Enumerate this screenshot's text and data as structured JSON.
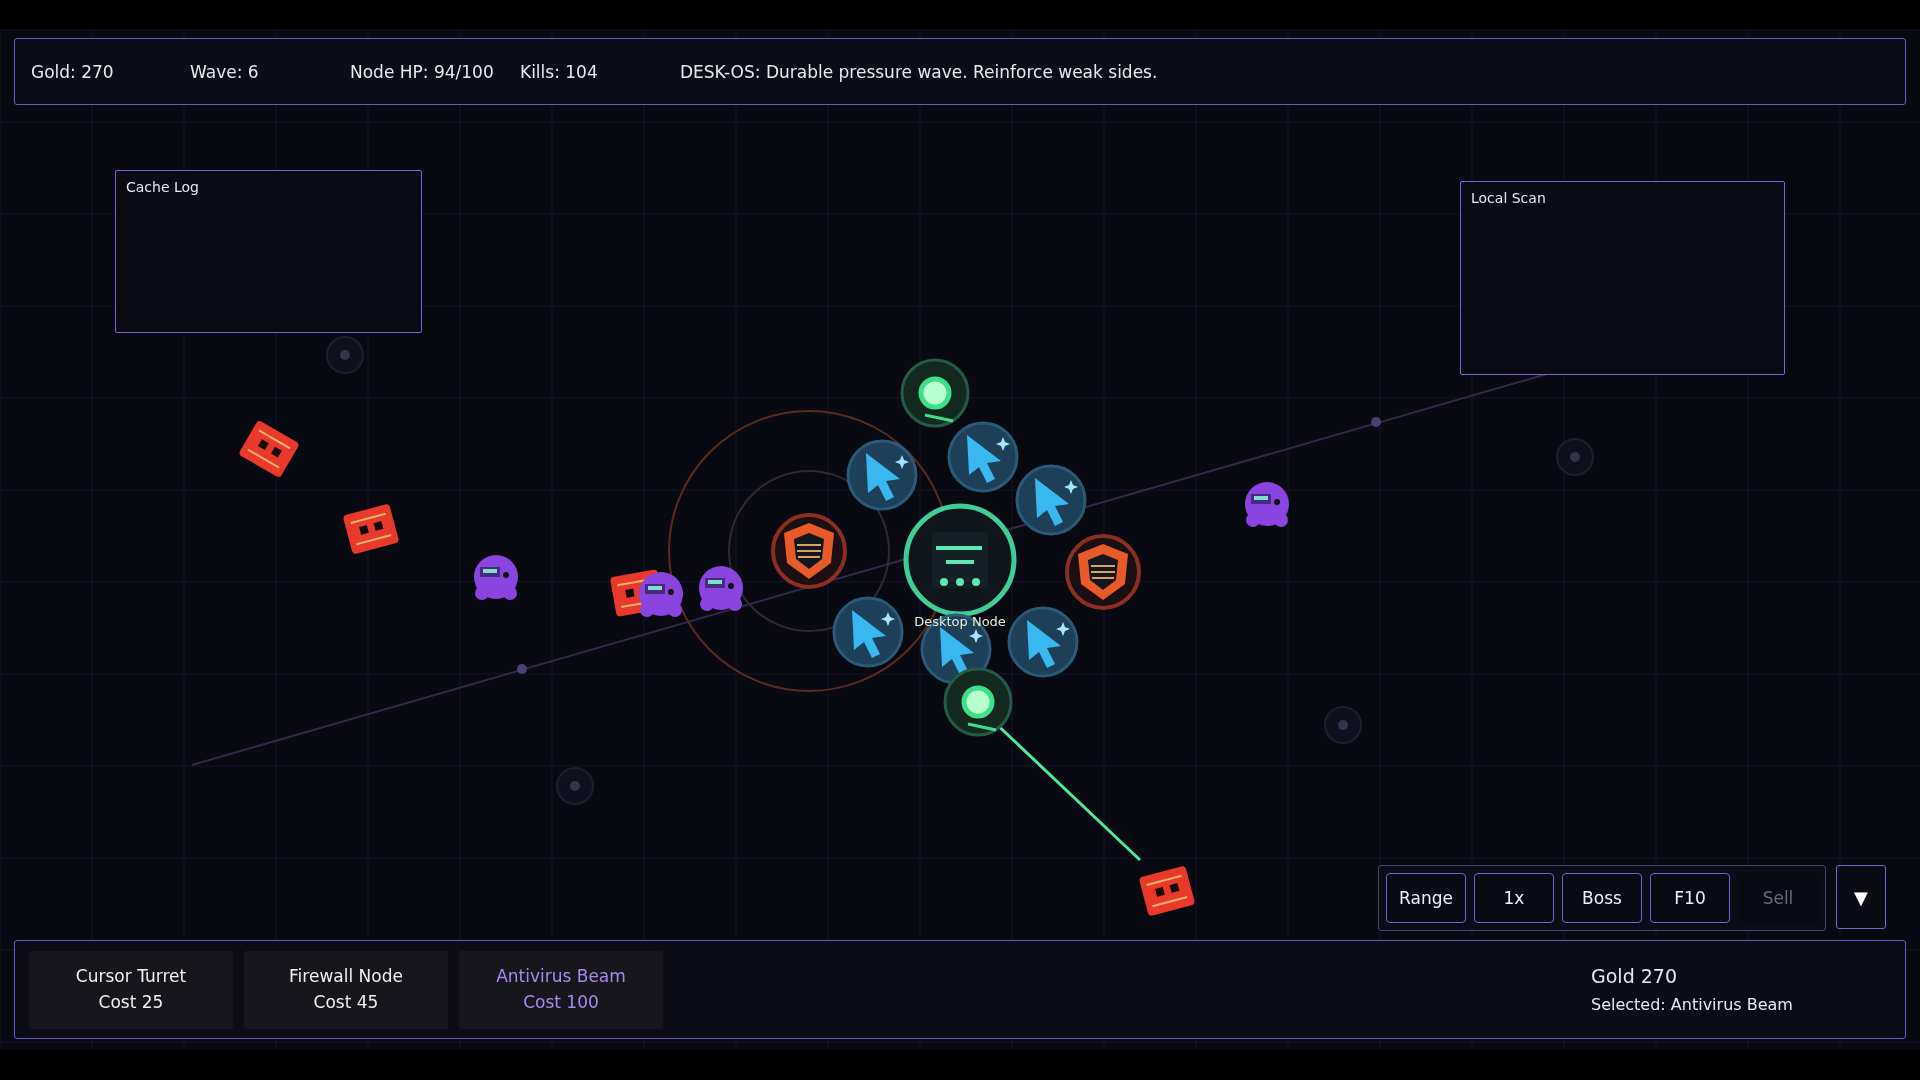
{
  "status": {
    "gold": "Gold: 270",
    "wave": "Wave: 6",
    "node_hp": "Node HP: 94/100",
    "kills": "Kills: 104",
    "message": "DESK-OS: Durable pressure wave. Reinforce weak sides."
  },
  "panels": [
    {
      "title": "Cache Log"
    },
    {
      "title": "Local Scan"
    }
  ],
  "map": {
    "core_label": "Desktop Node"
  },
  "controls": [
    {
      "label": "Range",
      "disabled": false
    },
    {
      "label": "1x",
      "disabled": false
    },
    {
      "label": "Boss",
      "disabled": false
    },
    {
      "label": "F10",
      "disabled": false
    },
    {
      "label": "Sell",
      "disabled": true
    }
  ],
  "menu_toggle": "▼",
  "shop": [
    {
      "name": "Cursor Turret",
      "cost": "Cost 25",
      "selected": false
    },
    {
      "name": "Firewall Node",
      "cost": "Cost 45",
      "selected": false
    },
    {
      "name": "Antivirus Beam",
      "cost": "Cost 100",
      "selected": true
    }
  ],
  "summary": {
    "gold": "Gold 270",
    "selected": "Selected: Antivirus Beam"
  }
}
